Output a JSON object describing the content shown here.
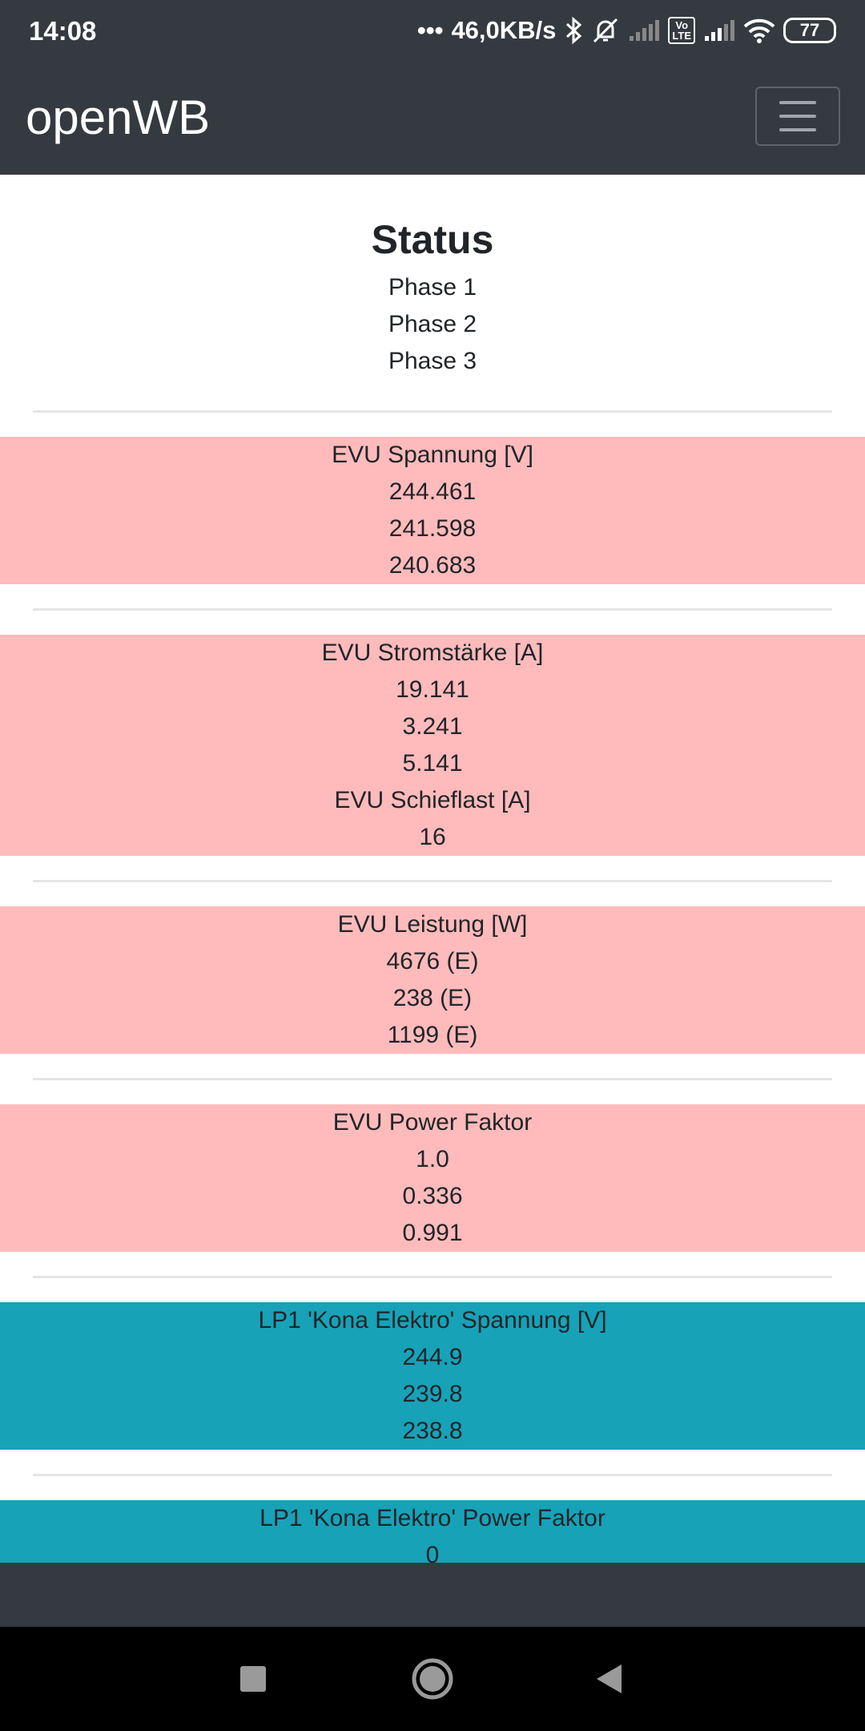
{
  "status_bar": {
    "time": "14:08",
    "dots": "•••",
    "speed": "46,0KB/s",
    "volte": "Vo\nLTE",
    "battery": "77",
    "icons": [
      "bluetooth-icon",
      "mute-alarm-icon",
      "signal-icon",
      "volte-icon",
      "signal-icon",
      "wifi-icon",
      "battery-icon"
    ]
  },
  "navbar": {
    "brand": "openWB",
    "menu_icon": "hamburger-menu-icon"
  },
  "page": {
    "title": "Status",
    "phases": [
      "Phase 1",
      "Phase 2",
      "Phase 3"
    ]
  },
  "sections": {
    "evu_spannung": {
      "label": "EVU Spannung [V]",
      "values": [
        "244.461",
        "241.598",
        "240.683"
      ],
      "color": "#ffbbbb"
    },
    "evu_strom": {
      "label": "EVU Stromstärke [A]",
      "values": [
        "19.141",
        "3.241",
        "5.141"
      ],
      "schieflast_label": "EVU Schieflast [A]",
      "schieflast_value": "16",
      "color": "#ffbbbb"
    },
    "evu_leistung": {
      "label": "EVU Leistung [W]",
      "values": [
        "4676 (E)",
        "238 (E)",
        "1199 (E)"
      ],
      "color": "#ffbbbb"
    },
    "evu_pf": {
      "label": "EVU Power Faktor",
      "values": [
        "1.0",
        "0.336",
        "0.991"
      ],
      "color": "#ffbbbb"
    },
    "lp1_spannung": {
      "label": "LP1 'Kona Elektro' Spannung [V]",
      "values": [
        "244.9",
        "239.8",
        "238.8"
      ],
      "color": "#17a2b8"
    },
    "lp1_pf": {
      "label": "LP1 'Kona Elektro' Power Faktor",
      "values": [
        "0"
      ],
      "color": "#17a2b8"
    }
  },
  "system_nav": {
    "icons": [
      "recents-square-icon",
      "home-circle-icon",
      "back-triangle-icon"
    ]
  }
}
